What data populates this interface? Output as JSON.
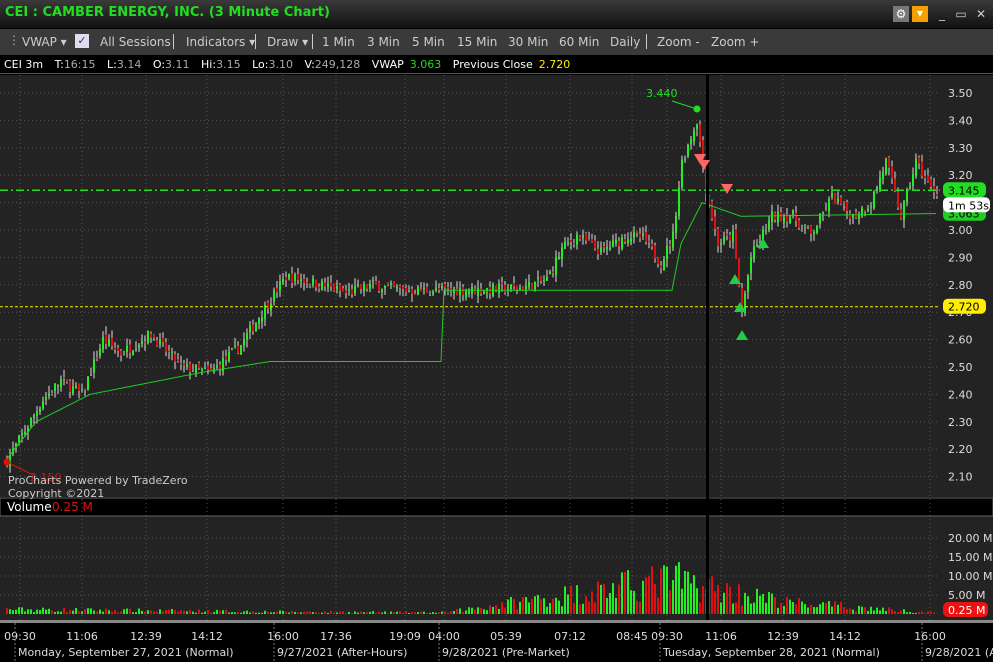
{
  "window": {
    "title": "CEI : CAMBER ENERGY, INC. (3 Minute Chart)"
  },
  "toolbar": {
    "vwap": "VWAP ▾",
    "all_sessions": "All Sessions",
    "indicators": "Indicators ▾",
    "draw": "Draw ▾",
    "intervals": [
      "1 Min",
      "3 Min",
      "5 Min",
      "15 Min",
      "30 Min",
      "60 Min",
      "Daily"
    ],
    "zoom_out": "Zoom -",
    "zoom_in": "Zoom +"
  },
  "info": {
    "symbol": "CEI 3m",
    "t_label": "T:",
    "t": "16:15",
    "l_label": "L:",
    "l": "3.14",
    "o_label": "O:",
    "o": "3.11",
    "hi_label": "Hi:",
    "hi": "3.15",
    "lo_label": "Lo:",
    "lo": "3.10",
    "v_label": "V:",
    "v": "249,128",
    "vwap_label": "VWAP",
    "vwap": "3.063",
    "prev_label": "Previous Close",
    "prev": "2.720"
  },
  "watermark": {
    "line1": "ProCharts Powered by TradeZero",
    "line2": "Copyright ©2021"
  },
  "volume_header": {
    "label": "Volume",
    "value": "0.25 M"
  },
  "badges": {
    "last": "3.145",
    "countdown": "1m 53s",
    "vwap": "3.063",
    "prev_close": "2.720",
    "high": "3.440",
    "low": "2.150",
    "volume": "0.25 M"
  },
  "colors": {
    "up": "#22ee22",
    "down": "#dd1111",
    "vwap": "#22cc22",
    "prev_close": "#ffee00",
    "last": "#22dd22"
  },
  "chart_data": {
    "type": "candlestick",
    "title": "CEI : CAMBER ENERGY, INC. (3 Minute Chart)",
    "ylim": [
      2.05,
      3.55
    ],
    "y_ticks": [
      "3.50",
      "3.40",
      "3.30",
      "3.20",
      "3.10",
      "3.00",
      "2.90",
      "2.80",
      "2.70",
      "2.60",
      "2.50",
      "2.40",
      "2.30",
      "2.20",
      "2.10"
    ],
    "volume_ticks": [
      "20.00 M",
      "15.00 M",
      "10.00 M",
      "5.00 M"
    ],
    "x_ticks": [
      "09:30",
      "11:06",
      "12:39",
      "14:12",
      "16:00",
      "17:36",
      "19:09",
      "04:00",
      "05:39",
      "07:12",
      "08:45",
      "09:30",
      "11:06",
      "12:39",
      "14:12",
      "16:00"
    ],
    "sessions": [
      "Monday, September 27, 2021 (Normal)",
      "9/27/2021 (After-Hours)",
      "9/28/2021 (Pre-Market)",
      "Tuesday, September 28, 2021 (Normal)",
      "9/28/2021 (Af"
    ],
    "bars_total": 311,
    "price_path": [
      [
        0,
        2.16
      ],
      [
        5,
        2.25
      ],
      [
        12,
        2.38
      ],
      [
        18,
        2.45
      ],
      [
        25,
        2.4
      ],
      [
        32,
        2.6
      ],
      [
        38,
        2.55
      ],
      [
        48,
        2.62
      ],
      [
        58,
        2.5
      ],
      [
        68,
        2.48
      ],
      [
        78,
        2.58
      ],
      [
        88,
        2.75
      ],
      [
        93,
        2.83
      ],
      [
        98,
        2.82
      ],
      [
        105,
        2.8
      ],
      [
        113,
        2.77
      ],
      [
        122,
        2.8
      ],
      [
        132,
        2.78
      ],
      [
        145,
        2.78
      ],
      [
        155,
        2.78
      ],
      [
        172,
        2.79
      ],
      [
        180,
        2.82
      ],
      [
        185,
        2.93
      ],
      [
        190,
        2.98
      ],
      [
        198,
        2.92
      ],
      [
        207,
        2.98
      ],
      [
        212,
        2.97
      ],
      [
        218,
        2.88
      ],
      [
        222,
        2.98
      ],
      [
        225,
        3.25
      ],
      [
        230,
        3.4
      ],
      [
        233,
        3.15
      ],
      [
        237,
        2.95
      ],
      [
        242,
        2.98
      ],
      [
        245,
        2.7
      ],
      [
        248,
        2.9
      ],
      [
        255,
        3.05
      ],
      [
        262,
        3.05
      ],
      [
        268,
        2.98
      ],
      [
        275,
        3.12
      ],
      [
        282,
        3.05
      ],
      [
        288,
        3.1
      ],
      [
        293,
        3.25
      ],
      [
        298,
        3.05
      ],
      [
        303,
        3.25
      ],
      [
        308,
        3.15
      ],
      [
        310,
        3.14
      ]
    ],
    "vwap_path": [
      [
        0,
        2.16
      ],
      [
        10,
        2.3
      ],
      [
        28,
        2.4
      ],
      [
        65,
        2.48
      ],
      [
        88,
        2.52
      ],
      [
        145,
        2.52
      ],
      [
        146,
        2.78
      ],
      [
        222,
        2.78
      ],
      [
        225,
        2.95
      ],
      [
        232,
        3.1
      ],
      [
        245,
        3.05
      ],
      [
        310,
        3.06
      ]
    ],
    "previous_close": 2.72,
    "last": 3.145,
    "vwap": 3.063,
    "volume_levels_M": [
      [
        0,
        1.2
      ],
      [
        90,
        0.6
      ],
      [
        146,
        0.4
      ],
      [
        222,
        9
      ],
      [
        240,
        6
      ],
      [
        260,
        3
      ],
      [
        310,
        0.25
      ]
    ]
  }
}
